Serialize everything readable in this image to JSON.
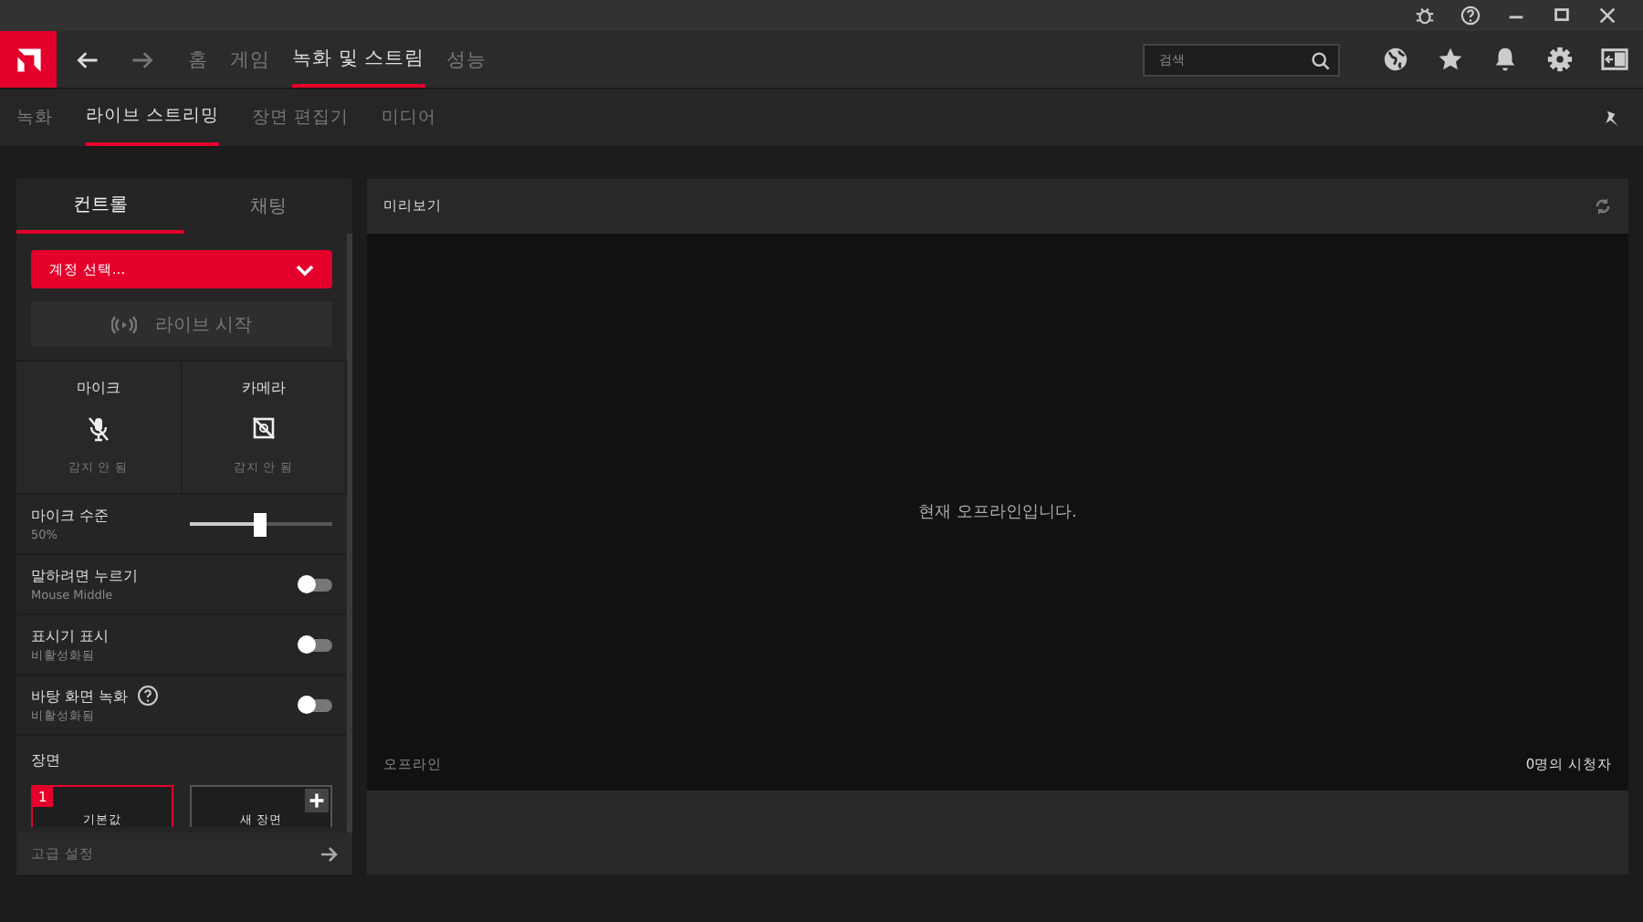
{
  "nav": {
    "tabs": [
      {
        "label": "홈",
        "selected": false
      },
      {
        "label": "게임",
        "selected": false
      },
      {
        "label": "녹화 및 스트림",
        "selected": true
      },
      {
        "label": "성능",
        "selected": false
      }
    ],
    "search": {
      "placeholder": "검색"
    }
  },
  "subnav": {
    "tabs": [
      {
        "label": "녹화",
        "selected": false
      },
      {
        "label": "라이브 스트리밍",
        "selected": true
      },
      {
        "label": "장면 편집기",
        "selected": false
      },
      {
        "label": "미디어",
        "selected": false
      }
    ]
  },
  "panel": {
    "tabs": [
      {
        "label": "컨트롤",
        "selected": true
      },
      {
        "label": "채팅",
        "selected": false
      }
    ],
    "account": "계정 선택...",
    "live_button": {
      "label": "라이브 시작",
      "disabled": true
    },
    "devices": [
      {
        "kind": "mic",
        "label": "마이크",
        "status": "감지 안 됨"
      },
      {
        "kind": "camera",
        "label": "카메라",
        "status": "감지 안 됨"
      }
    ],
    "mic_level": {
      "label": "마이크 수준",
      "reading": "50%",
      "level": 0.5
    },
    "toggles": [
      {
        "label": "말하려면 누르기",
        "sublabel": "Mouse Middle",
        "on": false,
        "help": false
      },
      {
        "label": "표시기 표시",
        "sublabel": "비활성화됨",
        "on": false,
        "help": false
      },
      {
        "label": "바탕 화면 녹화",
        "sublabel": "비활성화됨",
        "on": false,
        "help": true
      }
    ],
    "scenes": {
      "title": "장면",
      "items": [
        {
          "badge": "1",
          "label": "기본값",
          "selected": true
        },
        {
          "label": "새 장면",
          "selected": false
        }
      ]
    },
    "advanced": "고급 설정"
  },
  "preview": {
    "title": "미리보기",
    "message": "현재 오프라인입니다.",
    "status": "오프라인",
    "viewers": "0명의 시청자"
  }
}
